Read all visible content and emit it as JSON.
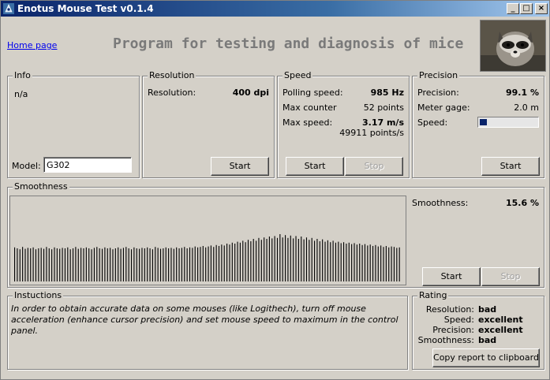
{
  "window": {
    "title": "Enotus Mouse Test v0.1.4",
    "buttons": {
      "minimize": "_",
      "maximize": "□",
      "close": "×"
    }
  },
  "header": {
    "home_link": "Home page",
    "banner": "Program for testing and diagnosis of mice"
  },
  "info": {
    "title": "Info",
    "text": "n/a",
    "model_label": "Model:",
    "model_value": "G302"
  },
  "resolution": {
    "title": "Resolution",
    "label": "Resolution:",
    "value": "400 dpi",
    "start": "Start"
  },
  "speed": {
    "title": "Speed",
    "polling_label": "Polling speed:",
    "polling_value": "985 Hz",
    "max_counter_label": "Max counter",
    "max_counter_value": "52 points",
    "max_speed_label": "Max  speed:",
    "max_speed_value": "3.17 m/s",
    "max_speed_points": "49911 points/s",
    "start": "Start",
    "stop": "Stop"
  },
  "precision": {
    "title": "Precision",
    "precision_label": "Precision:",
    "precision_value": "99.1 %",
    "meter_label": "Meter gage:",
    "meter_value": "2.0 m",
    "speed_label": "Speed:",
    "speed_level": 0.08,
    "start": "Start"
  },
  "smoothness": {
    "title": "Smoothness",
    "label": "Smoothness:",
    "value": "15.6 %",
    "start": "Start",
    "stop": "Stop",
    "bars": [
      0.72,
      0.7,
      0.68,
      0.73,
      0.69,
      0.71,
      0.7,
      0.72,
      0.68,
      0.7,
      0.71,
      0.69,
      0.73,
      0.7,
      0.68,
      0.72,
      0.7,
      0.69,
      0.71,
      0.7,
      0.72,
      0.68,
      0.7,
      0.73,
      0.69,
      0.71,
      0.7,
      0.72,
      0.7,
      0.68,
      0.71,
      0.73,
      0.7,
      0.69,
      0.72,
      0.7,
      0.71,
      0.68,
      0.7,
      0.72,
      0.69,
      0.71,
      0.73,
      0.7,
      0.68,
      0.72,
      0.7,
      0.69,
      0.71,
      0.7,
      0.72,
      0.7,
      0.68,
      0.73,
      0.71,
      0.69,
      0.7,
      0.72,
      0.7,
      0.71,
      0.69,
      0.72,
      0.7,
      0.71,
      0.73,
      0.7,
      0.72,
      0.71,
      0.74,
      0.72,
      0.73,
      0.75,
      0.72,
      0.74,
      0.76,
      0.73,
      0.77,
      0.75,
      0.78,
      0.76,
      0.8,
      0.78,
      0.82,
      0.8,
      0.84,
      0.82,
      0.86,
      0.83,
      0.88,
      0.85,
      0.9,
      0.86,
      0.92,
      0.88,
      0.93,
      0.9,
      0.95,
      0.91,
      0.96,
      0.92,
      1.0,
      0.93,
      0.98,
      0.92,
      0.97,
      0.91,
      0.96,
      0.9,
      0.95,
      0.89,
      0.93,
      0.88,
      0.92,
      0.86,
      0.9,
      0.85,
      0.89,
      0.84,
      0.87,
      0.83,
      0.86,
      0.82,
      0.84,
      0.81,
      0.83,
      0.8,
      0.82,
      0.79,
      0.81,
      0.78,
      0.8,
      0.77,
      0.79,
      0.76,
      0.78,
      0.75,
      0.77,
      0.74,
      0.76,
      0.73,
      0.75,
      0.72,
      0.74,
      0.73,
      0.71,
      0.72
    ]
  },
  "instructions": {
    "title": "Instuctions",
    "text": "In order to obtain accurate data on some mouses (like Logithech), turn off mouse acceleration (enhance cursor precision) and set mouse speed to maximum in the control panel."
  },
  "rating": {
    "title": "Rating",
    "items": [
      {
        "label": "Resolution:",
        "value": "bad"
      },
      {
        "label": "Speed:",
        "value": "excellent"
      },
      {
        "label": "Precision:",
        "value": "excellent"
      },
      {
        "label": "Smoothness:",
        "value": "bad"
      }
    ],
    "copy_button": "Copy report to clipboard"
  }
}
